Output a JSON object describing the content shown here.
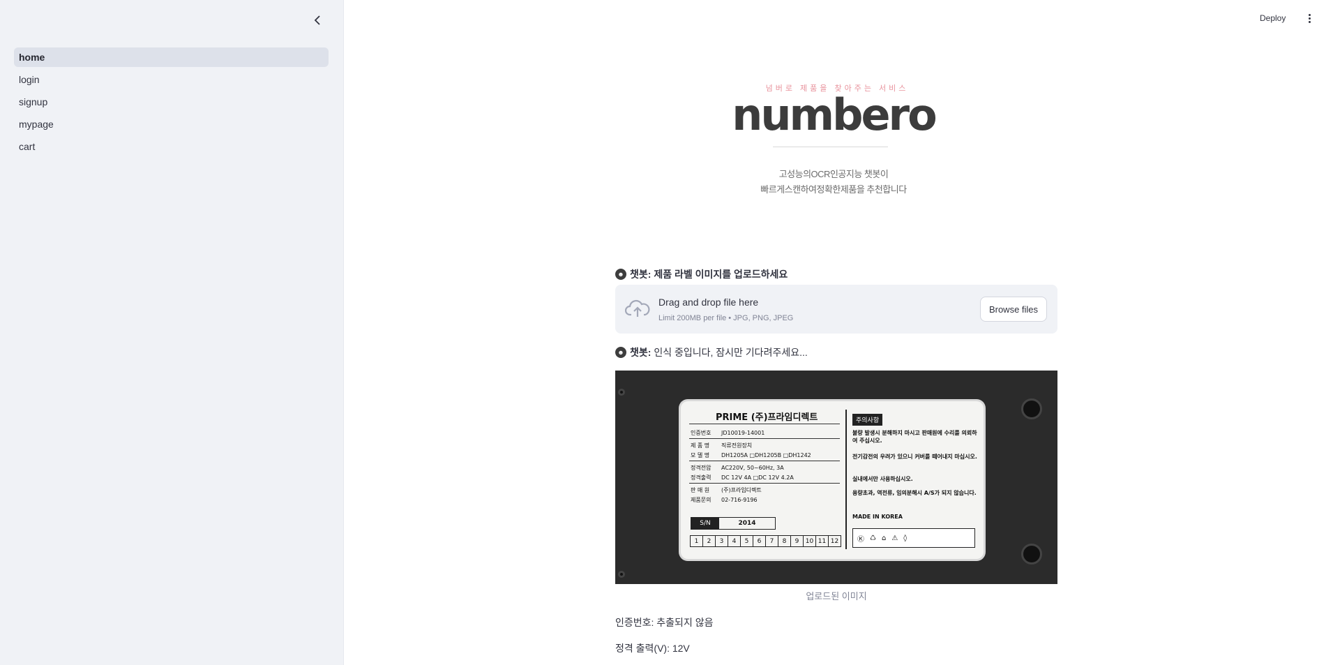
{
  "sidebar": {
    "collapse_icon": "chevron-left-icon",
    "items": [
      {
        "label": "home",
        "active": true
      },
      {
        "label": "login",
        "active": false
      },
      {
        "label": "signup",
        "active": false
      },
      {
        "label": "mypage",
        "active": false
      },
      {
        "label": "cart",
        "active": false
      }
    ]
  },
  "header": {
    "deploy_label": "Deploy",
    "menu_icon": "kebab-menu-icon"
  },
  "hero": {
    "tagline": "넘버로 제품을 찾아주는 서비스",
    "logo_text": "numbero",
    "subtitle_line1": "고성능의OCR인공지능 챗봇이",
    "subtitle_line2": "빠르게스캔하여정확한제품을 추천합니다"
  },
  "chat": {
    "prompt_prefix": "챗봇:",
    "prompt_text": " 제품 라벨 이미지를 업로드하세요",
    "status_prefix": "챗봇:",
    "status_text": " 인식 중입니다, 잠시만 기다려주세요..."
  },
  "uploader": {
    "title": "Drag and drop file here",
    "limit": "Limit 200MB per file • JPG, PNG, JPEG",
    "browse_label": "Browse files"
  },
  "image": {
    "caption": "업로드된 이미지",
    "label": {
      "brand": "PRIME (주)프라임디렉트",
      "cert_label": "인증번호",
      "cert_value": "JD10019-14001",
      "product_label": "제 품 명",
      "product_value": "직류전원장치",
      "model_label": "모 델 명",
      "model_value": "DH1205A  □DH1205B  □DH1242",
      "input_label": "정격전압",
      "input_value": "AC220V, 50~60Hz, 3A",
      "output_label": "정격출력",
      "output_value": "DC 12V 4A  □DC 12V 4.2A",
      "seller_label": "판 매 원",
      "seller_value": "(주)프라임디렉트",
      "contact_label": "제품문의",
      "contact_value": "02-716-9196",
      "sn_label": "S/N",
      "sn_value": "2014",
      "months": [
        "1",
        "2",
        "3",
        "4",
        "5",
        "6",
        "7",
        "8",
        "9",
        "10",
        "11",
        "12"
      ],
      "warning_title": "주의사항",
      "warnings": [
        "불량 발생시 분해하지 마시고 판매원에 수리를 의뢰하여 주십시오.",
        "전기감전의 우려가 있으니 커버를 떼어내지 마십시오.",
        "실내에서만 사용하십시오.",
        "용량초과, 역전류, 임의분해시 A/S가 되지 않습니다.",
        "MADE IN KOREA"
      ]
    }
  },
  "results": {
    "cert": "인증번호: 추출되지 않음",
    "output": "정격 출력(V): 12V"
  }
}
